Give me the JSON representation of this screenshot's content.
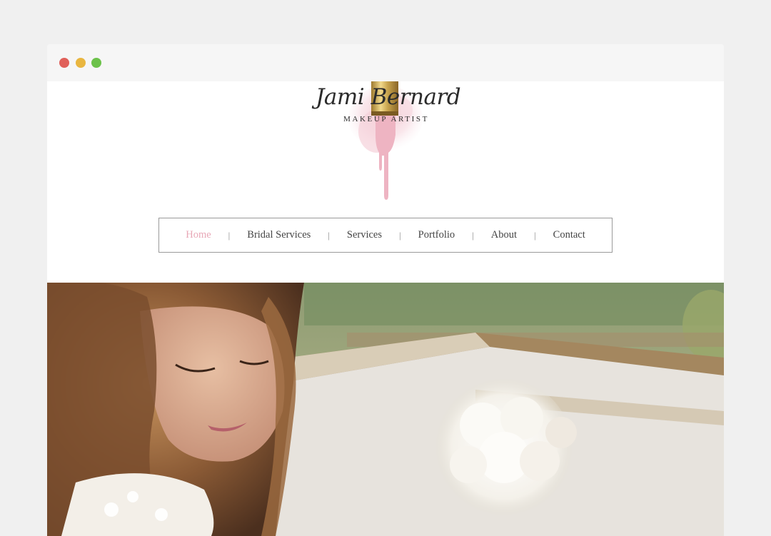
{
  "window": {
    "controls": [
      {
        "name": "close",
        "color": "#e0605a"
      },
      {
        "name": "minimize",
        "color": "#e9b640"
      },
      {
        "name": "maximize",
        "color": "#6cc24a"
      }
    ]
  },
  "logo": {
    "script_name": "Jami Bernard",
    "subtitle": "MAKEUP ARTIST",
    "accent_pink": "#f1c9d3",
    "accent_gold": "#c9a54f"
  },
  "nav": {
    "items": [
      {
        "label": "Home",
        "active": true
      },
      {
        "label": "Bridal Services",
        "active": false
      },
      {
        "label": "Services",
        "active": false
      },
      {
        "label": "Portfolio",
        "active": false
      },
      {
        "label": "About",
        "active": false
      },
      {
        "label": "Contact",
        "active": false
      }
    ],
    "separator": "|",
    "active_color": "#e8a7b6",
    "text_color": "#444444"
  },
  "hero": {
    "image": "bride-portrait-with-bouquet"
  }
}
